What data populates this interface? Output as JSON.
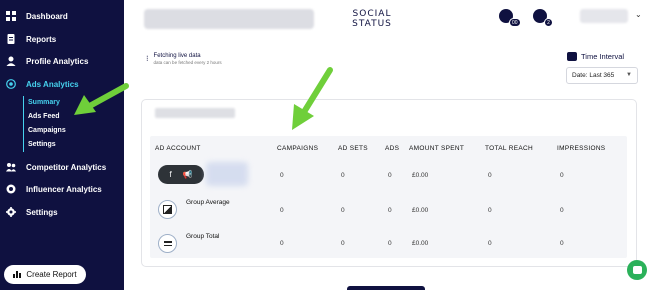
{
  "sidebar": {
    "items": [
      {
        "label": "Dashboard",
        "icon": "grid-icon"
      },
      {
        "label": "Reports",
        "icon": "document-icon"
      },
      {
        "label": "Profile Analytics",
        "icon": "user-icon"
      },
      {
        "label": "Ads Analytics",
        "icon": "target-icon"
      },
      {
        "label": "Competitor Analytics",
        "icon": "people-icon"
      },
      {
        "label": "Influencer Analytics",
        "icon": "circle-icon"
      },
      {
        "label": "Settings",
        "icon": "gear-icon"
      }
    ],
    "subitems": [
      "Summary",
      "Ads Feed",
      "Campaigns",
      "Settings"
    ],
    "create_report": "Create Report"
  },
  "header": {
    "logo_line1": "SOCIAL",
    "logo_line2": "STATUS",
    "badges": [
      "00",
      "2"
    ]
  },
  "fetch": {
    "title": "Fetching live data",
    "subtitle": "data can be fetched every 2 hours"
  },
  "interval": {
    "title": "Time Interval",
    "value": "Date: Last 365"
  },
  "table": {
    "headers": [
      "AD ACCOUNT",
      "CAMPAIGNS",
      "AD SETS",
      "ADS",
      "AMOUNT SPENT",
      "TOTAL REACH",
      "IMPRESSIONS"
    ],
    "rows": [
      {
        "label": "",
        "values": [
          "0",
          "0",
          "0",
          "£0.00",
          "0",
          "0"
        ]
      },
      {
        "label": "Group Average",
        "values": [
          "0",
          "0",
          "0",
          "£0.00",
          "0",
          "0"
        ]
      },
      {
        "label": "Group Total",
        "values": [
          "0",
          "0",
          "0",
          "£0.00",
          "0",
          "0"
        ]
      }
    ]
  },
  "colors": {
    "sidebar_bg": "#0f1140",
    "accent": "#46d2ee",
    "arrow": "#6fcf3a",
    "chat": "#2bb15a"
  }
}
